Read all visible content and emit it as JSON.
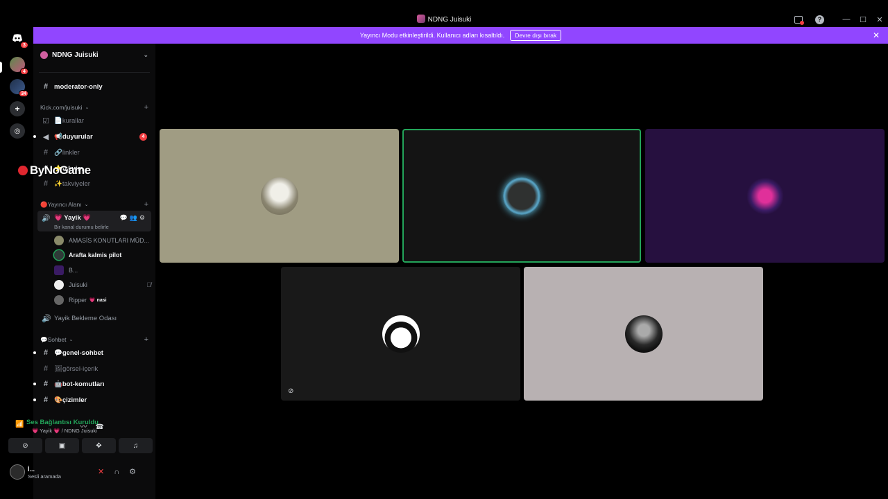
{
  "window": {
    "title": "NDNG Juisuki"
  },
  "banner": {
    "text": "Yayıncı Modu etkinleştirildi. Kullanıcı adları kısaltıldı.",
    "button": "Devre dışı bırak"
  },
  "rail": {
    "badges": [
      "3",
      "4",
      "34"
    ]
  },
  "sidebar": {
    "server_name": "NDNG Juisuki",
    "channels_top": [
      {
        "label": "moderator-only"
      }
    ],
    "category_kick": "Kick.com/juisuki",
    "kick_channels": [
      {
        "label": "📄kurallar"
      },
      {
        "label": "📢duyurular",
        "mentions": "4"
      },
      {
        "label": "🔗linkler"
      },
      {
        "label": "⭐takvim"
      },
      {
        "label": "✨takviyeler"
      }
    ],
    "category_streamer": "🔴Yayıncı Alanı",
    "voice_channel": {
      "name": "💗 Yayik 💗",
      "status": "Bir kanal durumu belirle"
    },
    "members": [
      {
        "name": "AMASİS KONUTLARI MÜD..."
      },
      {
        "name": "Arafta kalmis pilot"
      },
      {
        "name": "B..."
      },
      {
        "name": "Juisuki"
      },
      {
        "name": "Ripper",
        "tag": "💗 nasi"
      }
    ],
    "waiting_room": "Yayik Bekleme Odası",
    "category_chat": "💬Sohbet",
    "chat_channels": [
      {
        "label": "💬genel-sohbet"
      },
      {
        "label": "🖼görsel-içerik"
      },
      {
        "label": "🤖bot-komutları"
      },
      {
        "label": "🎨çizimler"
      }
    ]
  },
  "voice_panel": {
    "connection": "Ses Bağlantısı Kuruldu",
    "location": "💗 Yayik 💗 / NDNG Juisuki"
  },
  "user": {
    "name": "İ...",
    "status": "Sesli aramada"
  },
  "watermark": "ByNoGame",
  "colors": {
    "accent_banner": "#9146ff",
    "speaking_green": "#23a55a",
    "mention_red": "#f23f43"
  }
}
